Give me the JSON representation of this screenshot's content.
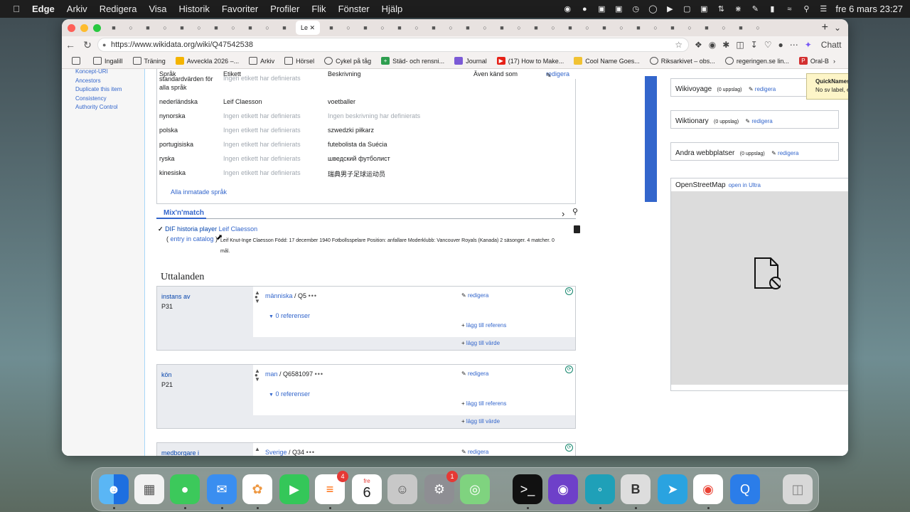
{
  "menubar": {
    "app": "Edge",
    "items": [
      "Arkiv",
      "Redigera",
      "Visa",
      "Historik",
      "Favoriter",
      "Profiler",
      "Flik",
      "Fönster",
      "Hjälp"
    ],
    "datetime": "fre 6 mars 23:27"
  },
  "browser": {
    "url": "https://www.wikidata.org/wiki/Q47542538",
    "active_tab": "Le",
    "chat_label": "Chatt",
    "bookmarks": [
      "Ingalill",
      "Träning",
      "Avveckla 2026 –...",
      "Arkiv",
      "Hörsel",
      "Cykel på tåg",
      "Städ- och rensni...",
      "Journal",
      "(17) How to Make...",
      "Cool Name Goes...",
      "Riksarkivet – obs...",
      "regeringen.se lin...",
      "Oral-B"
    ]
  },
  "sidebar": {
    "items": [
      "Koncept-URI",
      "Ancestors",
      "Duplicate this item",
      "Consistency",
      "Authority Control"
    ]
  },
  "labels_table": {
    "headers": {
      "lang": "Språk",
      "label": "Etikett",
      "desc": "Beskrivning",
      "alias": "Även känd som"
    },
    "edit": "redigera",
    "rows": [
      {
        "lang": "standardvärden för alla språk",
        "label": "Ingen etikett har definierats",
        "desc": ""
      },
      {
        "lang": "nederländska",
        "label": "Leif Claesson",
        "desc": "voetballer"
      },
      {
        "lang": "nynorska",
        "label": "Ingen etikett har definierats",
        "desc": "Ingen beskrivning har definierats"
      },
      {
        "lang": "polska",
        "label": "Ingen etikett har definierats",
        "desc": "szwedzki piłkarz"
      },
      {
        "lang": "portugisiska",
        "label": "Ingen etikett har definierats",
        "desc": "futebolista da Suécia"
      },
      {
        "lang": "ryska",
        "label": "Ingen etikett har definierats",
        "desc": "шведский футболист"
      },
      {
        "lang": "kinesiska",
        "label": "Ingen etikett har definierats",
        "desc": "瑞典男子足球运动员"
      }
    ],
    "all_languages": "Alla inmatade språk"
  },
  "mixnmatch": {
    "title": "Mix'n'match",
    "catalog": "DIF historia player",
    "name": "Leif Claesson",
    "entry_link": "entry in catalog",
    "description": "Leif Knut-Inge Claesson Född: 17 december 1940 Fotbollsspelare Position: anfallare Moderklubb: Vancouver Royals (Kanada) 2 säsonger. 4 matcher. 0 mål."
  },
  "statements": {
    "heading": "Uttalanden",
    "edit": "redigera",
    "add_ref": "lägg till referens",
    "add_value": "lägg till värde",
    "refs": "0 referenser",
    "items": [
      {
        "prop": "instans av",
        "pid": "P31",
        "value": "människa",
        "qid": "Q5"
      },
      {
        "prop": "kön",
        "pid": "P21",
        "value": "man",
        "qid": "Q6581097"
      },
      {
        "prop": "medborgare i",
        "pid": "",
        "value": "Sverige",
        "qid": "Q34"
      }
    ]
  },
  "sitelinks": [
    {
      "name": "Wikivoyage",
      "count": "(0 uppslag)"
    },
    {
      "name": "Wiktionary",
      "count": "(0 uppslag)"
    },
    {
      "name": "Andra webbplatser",
      "count": "(0 uppslag)"
    }
  ],
  "osm": {
    "title": "OpenStreetMap",
    "link": "open in Ultra"
  },
  "quicknames": {
    "title": "QuickNames",
    "text": "No sv label, exit"
  },
  "dock": {
    "calendar_month": "fre",
    "calendar_day": "6",
    "reminders_badge": "4",
    "settings_badge": "1"
  }
}
